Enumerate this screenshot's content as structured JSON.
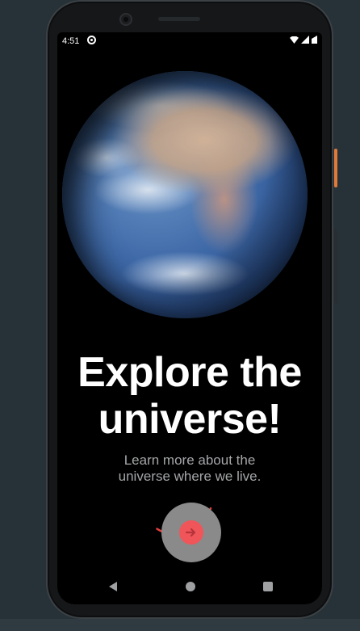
{
  "status_bar": {
    "time": "4:51",
    "icons": [
      "sync-icon",
      "wifi-icon",
      "signal-icon",
      "battery-icon"
    ]
  },
  "onboarding": {
    "title_line1": "Explore the",
    "title_line2": "universe!",
    "subtitle_line1": "Learn more about the",
    "subtitle_line2": "universe where we live.",
    "next_button_icon": "arrow-right-icon",
    "progress": 0.3
  },
  "colors": {
    "accent": "#f0555a",
    "button_bg": "#8a8a8a",
    "screen_bg": "#000000",
    "subtitle": "#a4a6a8"
  },
  "nav_bar": {
    "buttons": [
      "back-icon",
      "home-icon",
      "recent-apps-icon"
    ]
  }
}
